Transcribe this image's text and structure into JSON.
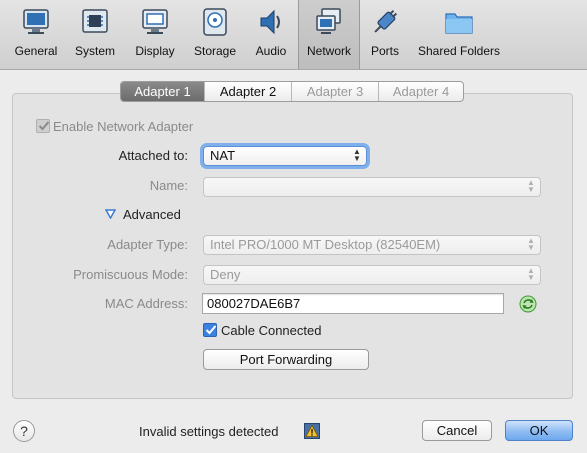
{
  "toolbar": {
    "items": [
      {
        "label": "General",
        "icon": "monitor-icon"
      },
      {
        "label": "System",
        "icon": "chip-icon"
      },
      {
        "label": "Display",
        "icon": "display-icon"
      },
      {
        "label": "Storage",
        "icon": "disk-icon"
      },
      {
        "label": "Audio",
        "icon": "speaker-icon"
      },
      {
        "label": "Network",
        "icon": "network-icon",
        "selected": true
      },
      {
        "label": "Ports",
        "icon": "plug-icon"
      },
      {
        "label": "Shared Folders",
        "icon": "folder-icon"
      }
    ]
  },
  "tabs": [
    {
      "label": "Adapter 1",
      "state": "active"
    },
    {
      "label": "Adapter 2",
      "state": "normal"
    },
    {
      "label": "Adapter 3",
      "state": "disabled"
    },
    {
      "label": "Adapter 4",
      "state": "disabled"
    }
  ],
  "form": {
    "enable_label": "Enable Network Adapter",
    "enable_checked": true,
    "attached_label": "Attached to:",
    "attached_value": "NAT",
    "name_label": "Name:",
    "name_value": "",
    "advanced_label": "Advanced",
    "adapter_type_label": "Adapter Type:",
    "adapter_type_value": "Intel PRO/1000 MT Desktop (82540EM)",
    "promiscuous_label": "Promiscuous Mode:",
    "promiscuous_value": "Deny",
    "mac_label": "MAC Address:",
    "mac_value": "080027DAE6B7",
    "cable_label": "Cable Connected",
    "cable_checked": true,
    "port_forwarding_label": "Port Forwarding"
  },
  "footer": {
    "help_label": "?",
    "status_text": "Invalid settings detected",
    "cancel_label": "Cancel",
    "ok_label": "OK"
  },
  "colors": {
    "accent": "#3b82e0",
    "default_button": "#8fbdf3",
    "refresh_green": "#3a9e2f",
    "warning_yellow": "#f2c230"
  }
}
